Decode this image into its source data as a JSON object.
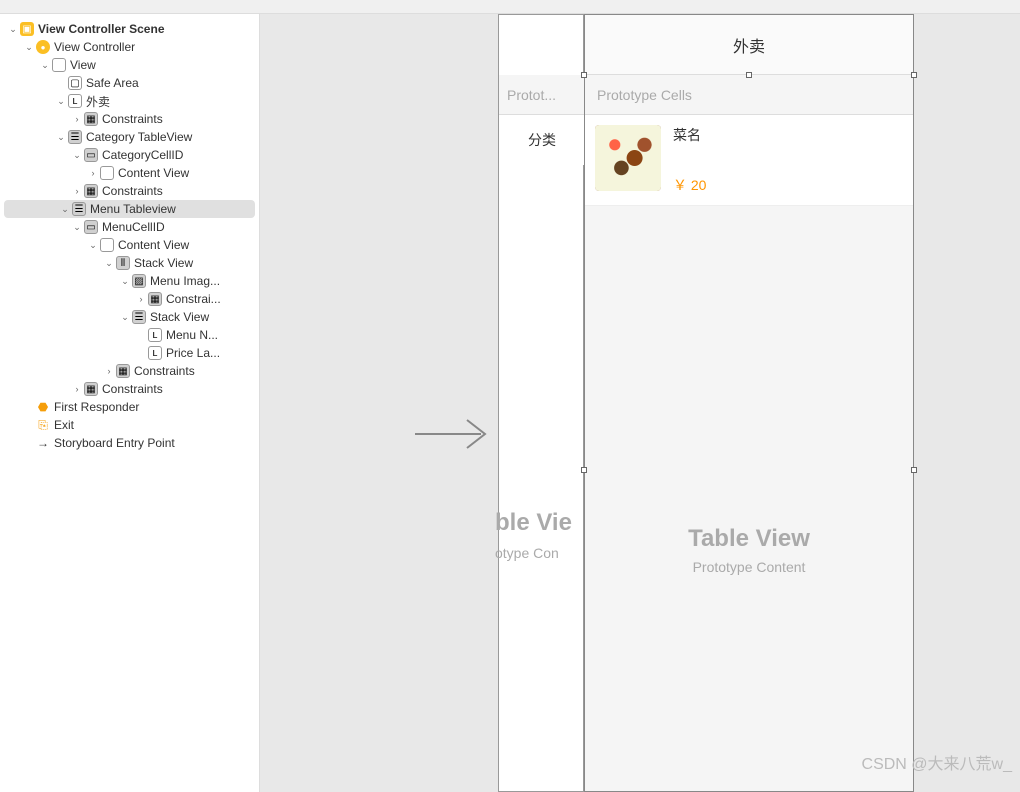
{
  "outline": {
    "scene": "View Controller Scene",
    "vc": "View Controller",
    "view": "View",
    "safeArea": "Safe Area",
    "label1": "外卖",
    "constraints": "Constraints",
    "categoryTable": "Category TableView",
    "categoryCell": "CategoryCellID",
    "contentView": "Content View",
    "menuTable": "Menu Tableview",
    "menuCell": "MenuCellID",
    "stackView": "Stack View",
    "menuImage": "Menu Imag...",
    "constraintsTrunc": "Constrai...",
    "menuName": "Menu N...",
    "priceLabel": "Price La...",
    "firstResponder": "First Responder",
    "exit": "Exit",
    "entryPoint": "Storyboard Entry Point"
  },
  "canvas": {
    "navTitle": "外卖",
    "prototypeHeader": "Prototype Cells",
    "leftProto": "Protot...",
    "leftCategory": "分类",
    "menuName": "菜名",
    "menuPrice": "￥ 20",
    "tablePlaceholder": "Table View",
    "tableSubPlaceholder": "Prototype Content",
    "partialTablePlaceholder": "ble Vie",
    "partialSubPlaceholder": "otype Con"
  },
  "watermark": "CSDN @大来八荒w_"
}
